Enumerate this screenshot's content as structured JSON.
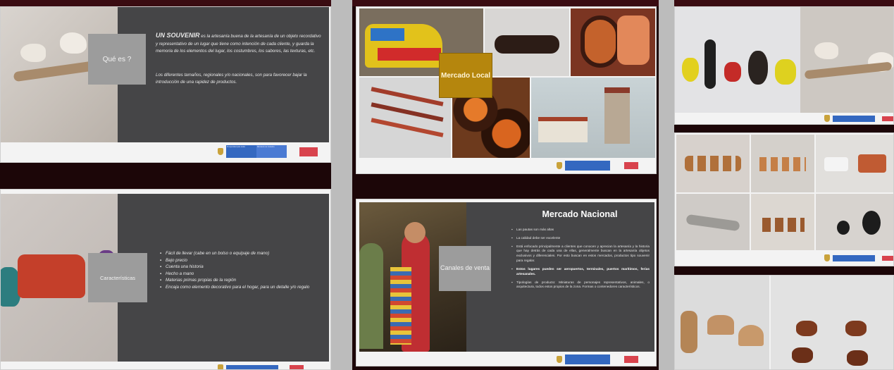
{
  "slide1": {
    "box_label": "Qué es ?",
    "lead": "UN SOUVENIR",
    "para1": "es la artesanía buena de la artesanía de un objeto recordativo y representativo de un lugar que tiene como intención de cada cliente, y guarda la memoria de los elementos del lugar, los costumbres, los sabores, las texturas, etc.",
    "para2": "Los diferentes tamaños, regionales y/o nacionales, son para favorecer bajar la introducción de una rapidez de productos."
  },
  "slide2": {
    "box_label": "Características",
    "items": [
      "Fácil de llevar (cabe en un bolso o equipaje de mano)",
      "Bajo precio",
      "Cuenta una historia",
      "Hecho a mano",
      "Materias primas propias de la región",
      "Encaja como elemento decorativo para el hogar, para un detalle y/o regalo"
    ]
  },
  "slide3": {
    "box_label": "Mercado Local"
  },
  "slide4": {
    "title": "Mercado Nacional",
    "box_label": "Canales de venta",
    "items": [
      "Las pautas son más altas",
      "La calidad debe ser excelente",
      "Está enfocado principalmente a clientes que conocen y aprecian la artesanía y la historia que hay detrás de cada una de ellas, generalmente buscan en la artesanía objetos exclusivos y diferenciales. Por esto buscan en estos mercados, productos tipo souvenir para regalar.",
      "Estos lugares pueden ser aeropuertos, terminales, puertos marítimos, ferias artesanales.",
      "Tipologías de producto: Miniaturas de personajes representativos, animales, o arquitectura, todos estos propios de la zona. Formas o contenedores característicos."
    ],
    "bold_phrase": "aeropuertos, terminales, puertos marítimos, ferias artesanales."
  },
  "footer": {
    "gov_label_1": "Prosperidad para todos",
    "gov_label_2": "Ministerio de Industria"
  },
  "colors": {
    "background": "#1c0608",
    "slide_dark": "#454547",
    "grey_box": "#9c9c9c",
    "gold_box": "#b5860d",
    "gov_blue": "#3468c0",
    "red_tag": "#d8434d"
  }
}
